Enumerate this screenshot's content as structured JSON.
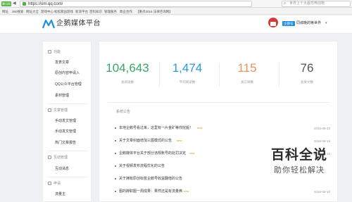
{
  "browser": {
    "tab_label": "腾讯网",
    "back_glyph": "◀",
    "forward_glyph": "▶",
    "url": "https://om.qq.com/",
    "search_placeholder": "世界上十大最恐怖动物",
    "bookmarks": [
      "网址",
      "360搜索",
      "网址大全",
      "游戏中心",
      "松松家园游戏",
      "新浪平台",
      "百科知识",
      "管理服务",
      "政企合作",
      "【重点2016 法律咨询网】"
    ]
  },
  "header": {
    "logo_text": "企鹅媒体平台",
    "user_badge": "企鹅号",
    "user_name": "同城晚的等世界",
    "caret": "▾"
  },
  "sidebar": {
    "groups": [
      {
        "label": "功能",
        "items": [
          "发表文章",
          "原创内容申请入",
          "QQ公众平台管理",
          "素材管理"
        ]
      },
      {
        "label": "文章管理",
        "items": [
          "手动发文管理",
          "手动发文管理",
          "热门文章报告"
        ]
      },
      {
        "label": "互动管理",
        "items": [
          "互动消息"
        ]
      },
      {
        "label": "申请",
        "items": [
          "流量主"
        ]
      }
    ]
  },
  "stats": [
    {
      "value": "104,643",
      "label": "总阅读数",
      "color": "#3aa46a"
    },
    {
      "value": "1,474",
      "label": "平均阅读数",
      "color": "#2b9ad6"
    },
    {
      "value": "115",
      "label": "总订阅数",
      "color": "#e5945c"
    },
    {
      "value": "76",
      "label": "总发文数",
      "color": "#555555"
    }
  ],
  "notices": {
    "title": "系统公告",
    "new_tag": "new",
    "items": [
      {
        "text": "本地企鹅号看过来，这里有一片金矿等你挖掘！",
        "date": "2016-08-23",
        "is_new": true
      },
      {
        "text": "关于文章封面增加三图模式的公告",
        "date": "2016-08-19",
        "is_new": true
      },
      {
        "text": "企鹅媒体平台关于部分违规账号的处罚决定",
        "date": "2016-08-15",
        "is_new": true
      },
      {
        "text": "关于视频发布流程优化的公告",
        "date": "",
        "is_new": false
      },
      {
        "text": "关于拥有原创标签企鹅号收益翻倍的公告",
        "date": "",
        "is_new": false
      },
      {
        "text": "图的辞职图一周成果：果然还是有流量弗",
        "date": "2016-08-10",
        "is_new": true
      }
    ]
  },
  "watermark": {
    "line1": "百科全说",
    "line2": "助你轻松解决"
  }
}
